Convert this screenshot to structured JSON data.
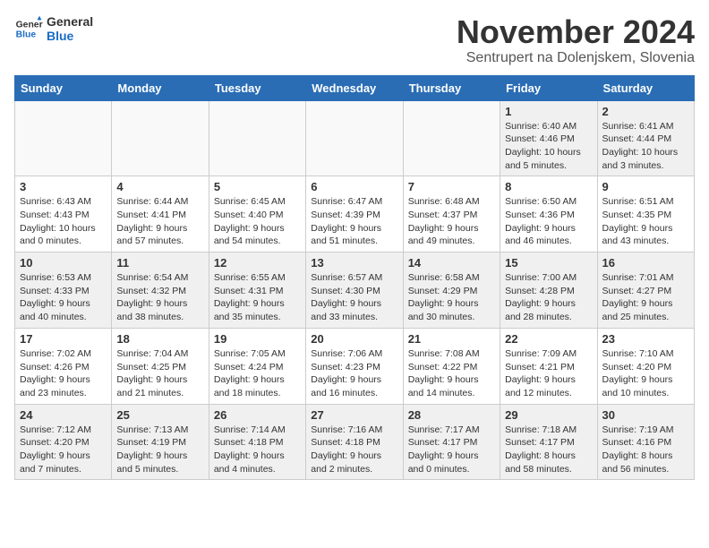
{
  "header": {
    "logo_general": "General",
    "logo_blue": "Blue",
    "month_title": "November 2024",
    "location": "Sentrupert na Dolenjskem, Slovenia"
  },
  "days_of_week": [
    "Sunday",
    "Monday",
    "Tuesday",
    "Wednesday",
    "Thursday",
    "Friday",
    "Saturday"
  ],
  "weeks": [
    [
      {
        "day": "",
        "info": ""
      },
      {
        "day": "",
        "info": ""
      },
      {
        "day": "",
        "info": ""
      },
      {
        "day": "",
        "info": ""
      },
      {
        "day": "",
        "info": ""
      },
      {
        "day": "1",
        "info": "Sunrise: 6:40 AM\nSunset: 4:46 PM\nDaylight: 10 hours and 5 minutes."
      },
      {
        "day": "2",
        "info": "Sunrise: 6:41 AM\nSunset: 4:44 PM\nDaylight: 10 hours and 3 minutes."
      }
    ],
    [
      {
        "day": "3",
        "info": "Sunrise: 6:43 AM\nSunset: 4:43 PM\nDaylight: 10 hours and 0 minutes."
      },
      {
        "day": "4",
        "info": "Sunrise: 6:44 AM\nSunset: 4:41 PM\nDaylight: 9 hours and 57 minutes."
      },
      {
        "day": "5",
        "info": "Sunrise: 6:45 AM\nSunset: 4:40 PM\nDaylight: 9 hours and 54 minutes."
      },
      {
        "day": "6",
        "info": "Sunrise: 6:47 AM\nSunset: 4:39 PM\nDaylight: 9 hours and 51 minutes."
      },
      {
        "day": "7",
        "info": "Sunrise: 6:48 AM\nSunset: 4:37 PM\nDaylight: 9 hours and 49 minutes."
      },
      {
        "day": "8",
        "info": "Sunrise: 6:50 AM\nSunset: 4:36 PM\nDaylight: 9 hours and 46 minutes."
      },
      {
        "day": "9",
        "info": "Sunrise: 6:51 AM\nSunset: 4:35 PM\nDaylight: 9 hours and 43 minutes."
      }
    ],
    [
      {
        "day": "10",
        "info": "Sunrise: 6:53 AM\nSunset: 4:33 PM\nDaylight: 9 hours and 40 minutes."
      },
      {
        "day": "11",
        "info": "Sunrise: 6:54 AM\nSunset: 4:32 PM\nDaylight: 9 hours and 38 minutes."
      },
      {
        "day": "12",
        "info": "Sunrise: 6:55 AM\nSunset: 4:31 PM\nDaylight: 9 hours and 35 minutes."
      },
      {
        "day": "13",
        "info": "Sunrise: 6:57 AM\nSunset: 4:30 PM\nDaylight: 9 hours and 33 minutes."
      },
      {
        "day": "14",
        "info": "Sunrise: 6:58 AM\nSunset: 4:29 PM\nDaylight: 9 hours and 30 minutes."
      },
      {
        "day": "15",
        "info": "Sunrise: 7:00 AM\nSunset: 4:28 PM\nDaylight: 9 hours and 28 minutes."
      },
      {
        "day": "16",
        "info": "Sunrise: 7:01 AM\nSunset: 4:27 PM\nDaylight: 9 hours and 25 minutes."
      }
    ],
    [
      {
        "day": "17",
        "info": "Sunrise: 7:02 AM\nSunset: 4:26 PM\nDaylight: 9 hours and 23 minutes."
      },
      {
        "day": "18",
        "info": "Sunrise: 7:04 AM\nSunset: 4:25 PM\nDaylight: 9 hours and 21 minutes."
      },
      {
        "day": "19",
        "info": "Sunrise: 7:05 AM\nSunset: 4:24 PM\nDaylight: 9 hours and 18 minutes."
      },
      {
        "day": "20",
        "info": "Sunrise: 7:06 AM\nSunset: 4:23 PM\nDaylight: 9 hours and 16 minutes."
      },
      {
        "day": "21",
        "info": "Sunrise: 7:08 AM\nSunset: 4:22 PM\nDaylight: 9 hours and 14 minutes."
      },
      {
        "day": "22",
        "info": "Sunrise: 7:09 AM\nSunset: 4:21 PM\nDaylight: 9 hours and 12 minutes."
      },
      {
        "day": "23",
        "info": "Sunrise: 7:10 AM\nSunset: 4:20 PM\nDaylight: 9 hours and 10 minutes."
      }
    ],
    [
      {
        "day": "24",
        "info": "Sunrise: 7:12 AM\nSunset: 4:20 PM\nDaylight: 9 hours and 7 minutes."
      },
      {
        "day": "25",
        "info": "Sunrise: 7:13 AM\nSunset: 4:19 PM\nDaylight: 9 hours and 5 minutes."
      },
      {
        "day": "26",
        "info": "Sunrise: 7:14 AM\nSunset: 4:18 PM\nDaylight: 9 hours and 4 minutes."
      },
      {
        "day": "27",
        "info": "Sunrise: 7:16 AM\nSunset: 4:18 PM\nDaylight: 9 hours and 2 minutes."
      },
      {
        "day": "28",
        "info": "Sunrise: 7:17 AM\nSunset: 4:17 PM\nDaylight: 9 hours and 0 minutes."
      },
      {
        "day": "29",
        "info": "Sunrise: 7:18 AM\nSunset: 4:17 PM\nDaylight: 8 hours and 58 minutes."
      },
      {
        "day": "30",
        "info": "Sunrise: 7:19 AM\nSunset: 4:16 PM\nDaylight: 8 hours and 56 minutes."
      }
    ]
  ]
}
